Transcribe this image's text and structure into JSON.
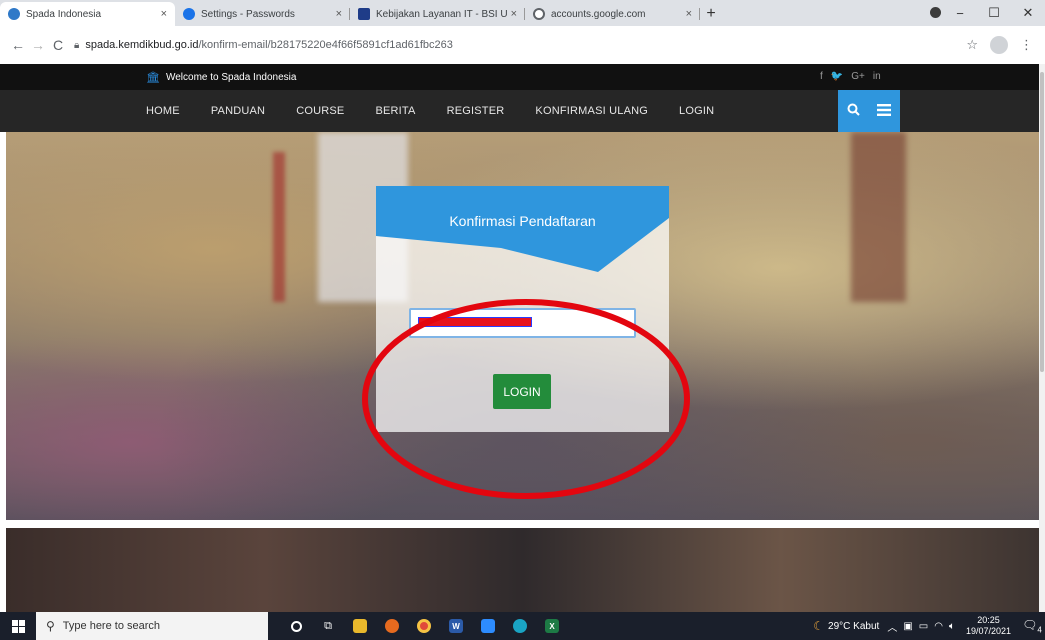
{
  "browser": {
    "tabs": [
      {
        "title": "Spada Indonesia",
        "favicon_color": "#2f79c8",
        "active": true
      },
      {
        "title": "Settings - Passwords",
        "favicon_color": "#1a73e8",
        "active": false
      },
      {
        "title": "Kebijakan Layanan IT - BSI UII",
        "favicon_color": "#1f3c88",
        "active": false
      },
      {
        "title": "accounts.google.com",
        "favicon_color": "#5f6368",
        "active": false
      }
    ],
    "close_glyph": "×",
    "new_tab_glyph": "+",
    "window_controls": {
      "minimize": "−",
      "maximize": "☐",
      "close": "✕"
    },
    "nav": {
      "back": "←",
      "forward": "→",
      "reload": "C"
    },
    "url": {
      "domain": "spada.kemdikbud.go.id",
      "path": "/konfirm-email/b28175220e4f66f5891cf1ad61fbc263"
    },
    "star_glyph": "☆",
    "menu_glyph": "⋮"
  },
  "site": {
    "welcome": "Welcome to Spada Indonesia",
    "socials": [
      "f",
      "🐦",
      "G+",
      "in"
    ],
    "nav_items": [
      "HOME",
      "PANDUAN",
      "COURSE",
      "BERITA",
      "REGISTER",
      "KONFIRMASI ULANG",
      "LOGIN"
    ],
    "accent_color": "#2f96dd"
  },
  "form": {
    "title": "Konfirmasi Pendaftaran",
    "code_value": "",
    "login_label": "LOGIN",
    "button_color": "#238c3b"
  },
  "taskbar": {
    "search_placeholder": "Type here to search",
    "weather": "29°C  Kabut",
    "time": "20:25",
    "date": "19/07/2021",
    "notification_count": "4"
  }
}
